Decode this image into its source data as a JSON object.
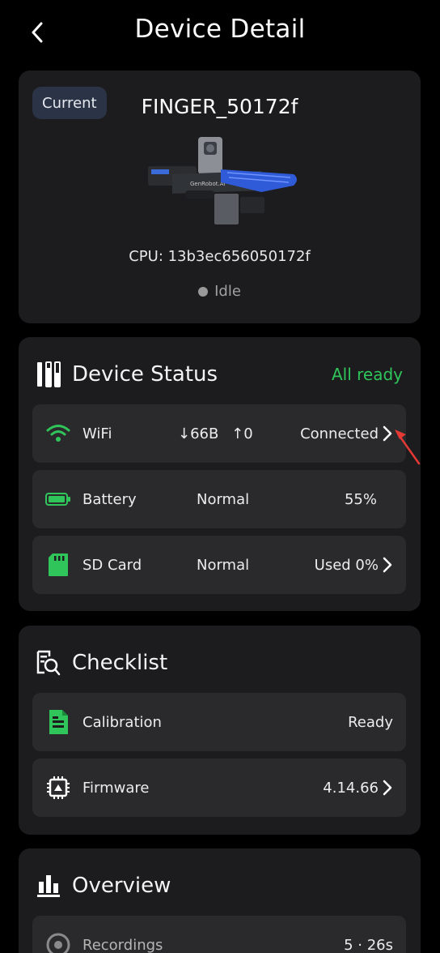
{
  "header": {
    "title": "Device Detail",
    "back_icon": "chevron-left-icon"
  },
  "device": {
    "badge": "Current",
    "name": "FINGER_50172f",
    "image_brand": "GenRobot.AI",
    "cpu_label": "CPU: 13b3ec656050172f",
    "state": "Idle"
  },
  "device_status": {
    "title": "Device Status",
    "status": "All ready",
    "status_color": "#2fc55a",
    "rows": [
      {
        "icon": "wifi-icon",
        "label": "WiFi",
        "mid_down": "66B",
        "mid_up": "0",
        "right": "Connected"
      },
      {
        "icon": "battery-icon",
        "label": "Battery",
        "mid": "Normal",
        "right": "55%",
        "level": 0.55
      },
      {
        "icon": "sd-card-icon",
        "label": "SD Card",
        "mid": "Normal",
        "right": "Used 0%"
      }
    ]
  },
  "checklist": {
    "title": "Checklist",
    "rows": [
      {
        "icon": "document-icon",
        "label": "Calibration",
        "right": "Ready"
      },
      {
        "icon": "chip-icon",
        "label": "Firmware",
        "right": "4.14.66"
      }
    ]
  },
  "overview": {
    "title": "Overview",
    "rows": [
      {
        "icon": "recordings-icon",
        "label": "Recordings",
        "right": "5 · 26s"
      }
    ]
  },
  "colors": {
    "accent_green": "#2fc55a",
    "card_bg": "#1c1c1e",
    "row_bg": "#2a2a2c",
    "pointer_red": "#e53935"
  }
}
